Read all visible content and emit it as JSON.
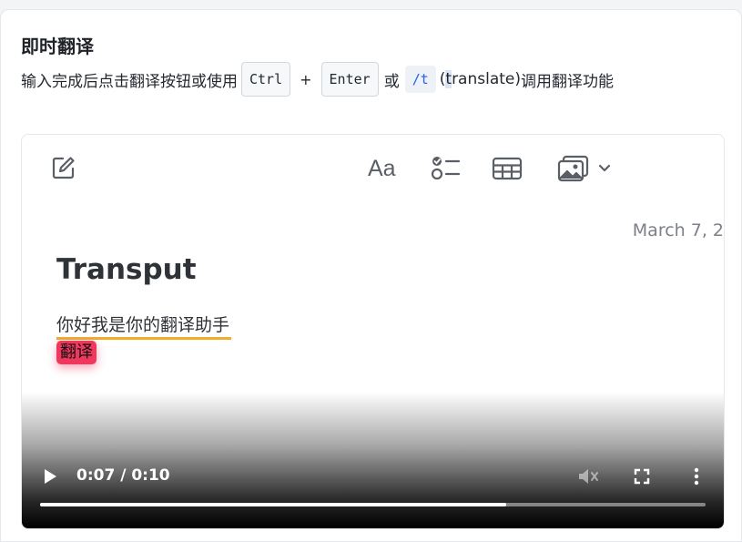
{
  "header": {
    "title": "即时翻译",
    "desc_prefix": "输入完成后点击翻译按钮或使用",
    "key_ctrl": "Ctrl",
    "plus": "+",
    "key_enter": "Enter",
    "or": "或",
    "slash_cmd": "/t",
    "paren_open": "(",
    "cmd_t": "t",
    "cmd_rest": "ranslate",
    "paren_close": ")",
    "desc_suffix": "调用翻译功能"
  },
  "editor": {
    "toolbar_icons": [
      "compose-icon",
      "text-format-icon",
      "checklist-icon",
      "table-icon",
      "media-icon",
      "chevron-down-icon"
    ],
    "date": "March 7, 2",
    "note_title": "Transput",
    "note_text": "你好我是你的翻译助手",
    "translate_button": "翻译"
  },
  "player": {
    "time": "0:07 / 0:10",
    "progress": 0.7,
    "controls": [
      "play-icon",
      "volume-muted-icon",
      "fullscreen-icon",
      "more-vert-icon"
    ]
  },
  "colors": {
    "accent_underline": "#f0ad2a",
    "translate_chip": "#f0385e",
    "code_text": "#2563eb"
  }
}
